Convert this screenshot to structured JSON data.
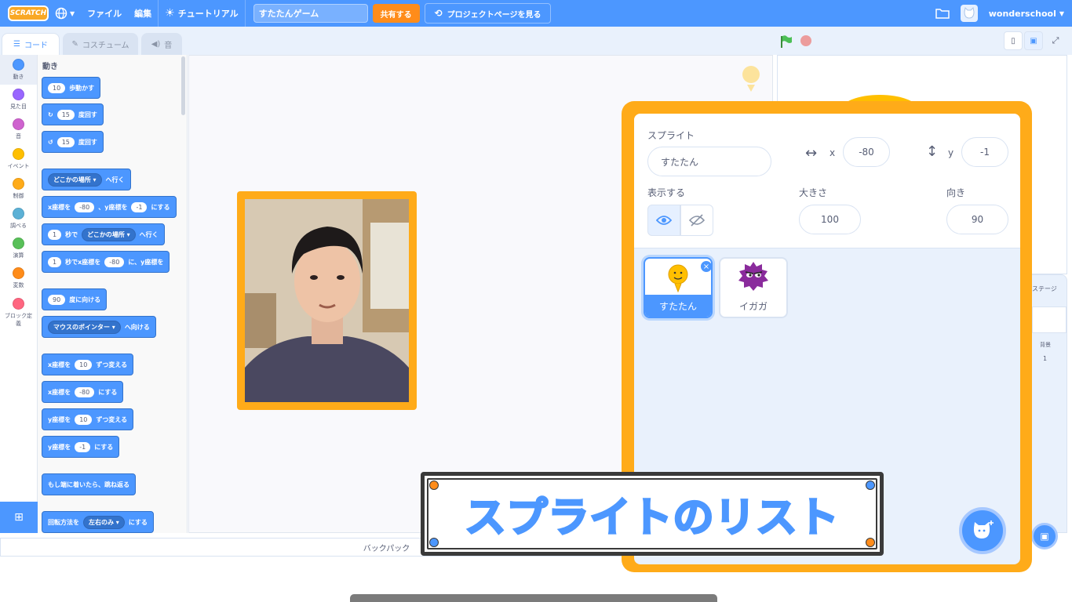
{
  "menubar": {
    "logo": "SCRATCH",
    "file": "ファイル",
    "edit": "編集",
    "tutorial": "チュートリアル",
    "project_title": "すたたんゲーム",
    "share": "共有する",
    "see_project": "プロジェクトページを見る",
    "username": "wonderschool"
  },
  "tabs": {
    "code": "コード",
    "costume": "コスチューム",
    "sound": "音"
  },
  "categories": [
    {
      "label": "動き",
      "color": "#4c97ff"
    },
    {
      "label": "見た目",
      "color": "#9966ff"
    },
    {
      "label": "音",
      "color": "#cf63cf"
    },
    {
      "label": "イベント",
      "color": "#ffbf00"
    },
    {
      "label": "制御",
      "color": "#ffab19"
    },
    {
      "label": "調べる",
      "color": "#5cb1d6"
    },
    {
      "label": "演算",
      "color": "#59c059"
    },
    {
      "label": "変数",
      "color": "#ff8c1a"
    },
    {
      "label": "ブロック定義",
      "color": "#ff6680"
    }
  ],
  "palette": {
    "heading": "動き",
    "blocks": {
      "move_num": "10",
      "move_text": "歩動かす",
      "turn_right_num": "15",
      "turn_right_text": "度回す",
      "turn_left_num": "15",
      "turn_left_text": "度回す",
      "goto_drop": "どこかの場所 ▾",
      "goto_text": "へ行く",
      "gotoxy_a": "x座標を",
      "gotoxy_x": "-80",
      "gotoxy_b": "、y座標を",
      "gotoxy_y": "-1",
      "gotoxy_c": "にする",
      "glide_num": "1",
      "glide_a": "秒で",
      "glide_drop": "どこかの場所 ▾",
      "glide_b": "へ行く",
      "glidexy_num": "1",
      "glidexy_a": "秒でx座標を",
      "glidexy_x": "-80",
      "glidexy_b": "に、y座標を",
      "point_num": "90",
      "point_text": "度に向ける",
      "pointto_drop": "マウスのポインター ▾",
      "pointto_text": "へ向ける",
      "changex_a": "x座標を",
      "changex_num": "10",
      "changex_b": "ずつ変える",
      "setx_a": "x座標を",
      "setx_num": "-80",
      "setx_b": "にする",
      "changey_a": "y座標を",
      "changey_num": "10",
      "changey_b": "ずつ変える",
      "sety_a": "y座標を",
      "sety_num": "-1",
      "sety_b": "にする",
      "bounce": "もし端に着いたら、跳ね返る",
      "rotstyle_a": "回転方法を",
      "rotstyle_drop": "左右のみ ▾",
      "rotstyle_b": "にする"
    }
  },
  "backpack": "バックパック",
  "stage_panel": {
    "tab": "ステージ",
    "backdrop_label": "背景",
    "backdrop_count": "1"
  },
  "sprite_info": {
    "sprite_label": "スプライト",
    "sprite_name": "すたたん",
    "x_label": "x",
    "x_value": "-80",
    "y_label": "y",
    "y_value": "-1",
    "show_label": "表示する",
    "size_label": "大きさ",
    "size_value": "100",
    "direction_label": "向き",
    "direction_value": "90"
  },
  "sprites": [
    {
      "name": "すたたん",
      "selected": true
    },
    {
      "name": "イガガ",
      "selected": false
    }
  ],
  "caption": "スプライトのリスト",
  "colors": {
    "accent": "#4c97ff",
    "highlight": "#ffab19",
    "caption_fill": "#ffb21a"
  }
}
